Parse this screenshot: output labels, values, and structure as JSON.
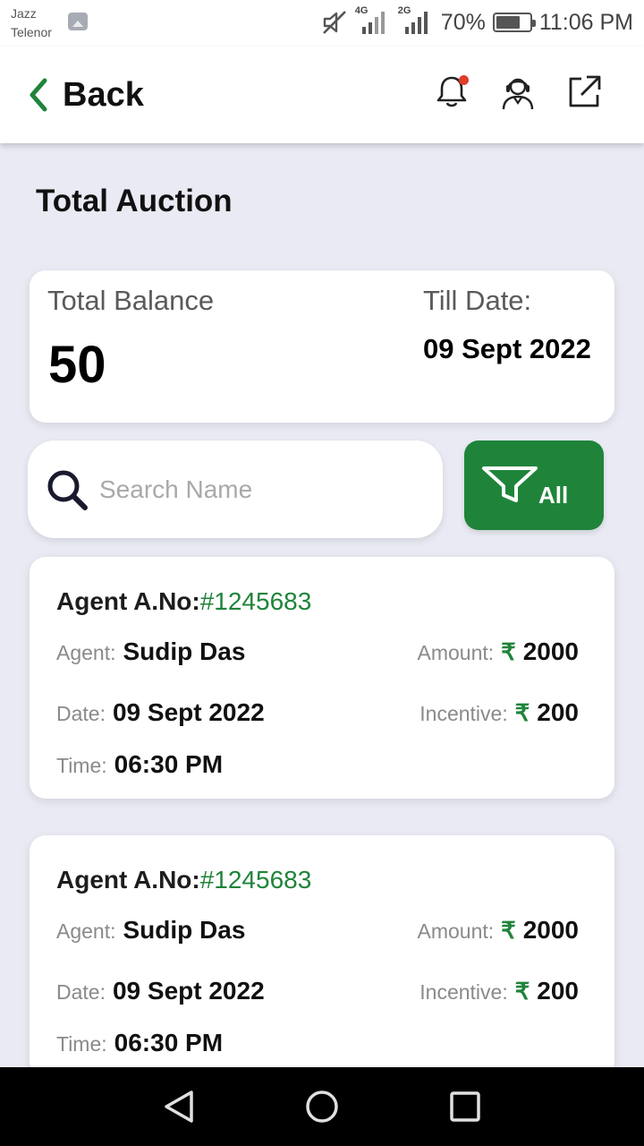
{
  "status_bar": {
    "carrier_line1": "Jazz",
    "carrier_line2": "Telenor",
    "network1": "4G",
    "network2": "2G",
    "battery": "70%",
    "time": "11:06 PM"
  },
  "header": {
    "back_label": "Back",
    "icons": [
      "notification-bell-icon",
      "support-agent-icon",
      "external-link-icon"
    ],
    "accent_color": "#1f843a",
    "notification_dot_color": "#e23c2c"
  },
  "page": {
    "title": "Total Auction"
  },
  "balance": {
    "label": "Total Balance",
    "value": "50",
    "till_label": "Till Date:",
    "till_value": "09 Sept 2022"
  },
  "search": {
    "placeholder": "Search Name",
    "value": ""
  },
  "filter": {
    "label": "All"
  },
  "labels": {
    "agent_no": "Agent A.No:",
    "agent": "Agent:",
    "date": "Date:",
    "time": "Time:",
    "amount": "Amount:",
    "incentive": "Incentive:",
    "currency": "₹"
  },
  "auctions": [
    {
      "number": "#1245683",
      "agent": "Sudip Das",
      "date": "09 Sept 2022",
      "time": "06:30 PM",
      "amount": "2000",
      "incentive": "200"
    },
    {
      "number": "#1245683",
      "agent": "Sudip Das",
      "date": "09 Sept 2022",
      "time": "06:30 PM",
      "amount": "2000",
      "incentive": "200"
    }
  ]
}
